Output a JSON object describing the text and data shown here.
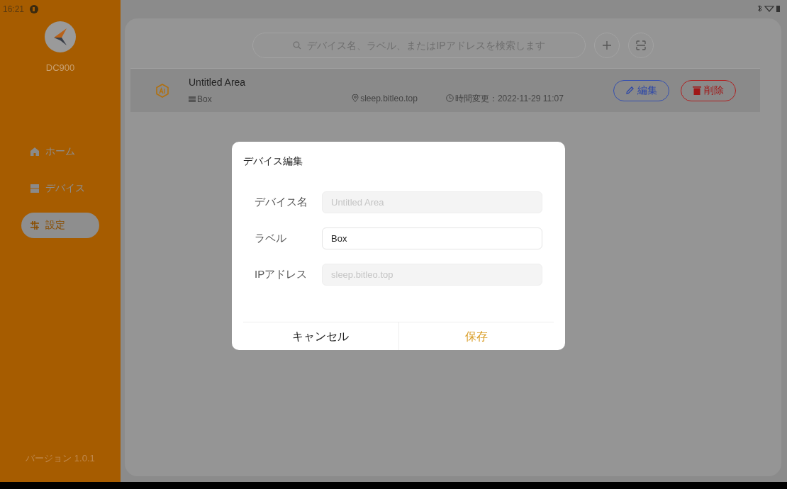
{
  "status_bar": {
    "time": "16:21"
  },
  "sidebar": {
    "app_name": "DC900",
    "items": [
      {
        "kind": "home",
        "label": "ホーム",
        "selected": false
      },
      {
        "kind": "devices",
        "label": "デバイス",
        "selected": false
      },
      {
        "kind": "settings",
        "label": "設定",
        "selected": true
      }
    ],
    "version": "バージョン 1.0.1"
  },
  "search": {
    "placeholder": "デバイス名、ラベル、またはIPアドレスを検索します"
  },
  "devices": [
    {
      "name": "Untitled Area",
      "label": "Box",
      "address": "sleep.bitleo.top",
      "time": "時間変更：2022-11-29 11:07",
      "edit": "編集",
      "delete": "削除"
    }
  ],
  "dialog": {
    "title": "デバイス編集",
    "fields": [
      {
        "label": "デバイス名",
        "value": "Untitled Area",
        "disabled": true
      },
      {
        "label": "ラベル",
        "value": "Box",
        "disabled": false
      },
      {
        "label": "IPアドレス",
        "value": "sleep.bitleo.top",
        "disabled": true
      }
    ],
    "cancel": "キャンセル",
    "save": "保存"
  }
}
